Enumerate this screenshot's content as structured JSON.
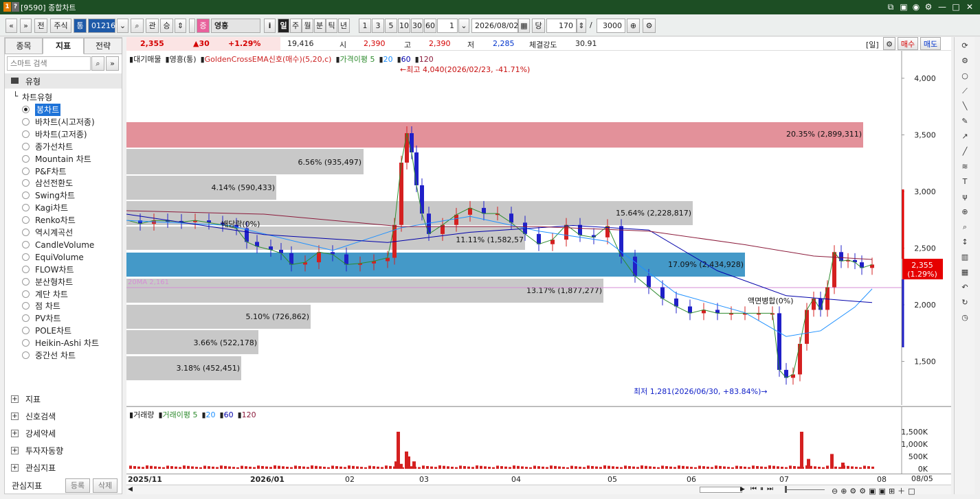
{
  "window": {
    "title": "[9590] 종합차트",
    "logo": "1 ?"
  },
  "toolbar": {
    "nav_prev": "«",
    "nav_down": "»",
    "before": "전",
    "asset_type": "주식",
    "tong": "통",
    "code": "012160",
    "gwan": "관",
    "seung": "승",
    "jeung": "증",
    "name": "영흥",
    "info": "i",
    "periods": [
      "일",
      "주",
      "월",
      "분",
      "틱",
      "년"
    ],
    "minutes": [
      "1",
      "3",
      "5",
      "10",
      "30",
      "60"
    ],
    "interval_value": "1",
    "date": "2026/08/02",
    "dang": "당",
    "count": "170",
    "slash": "/",
    "max_count": "3000"
  },
  "left_tabs": [
    "종목",
    "지표",
    "전략"
  ],
  "search_placeholder": "스마트 검색",
  "tree": {
    "root": "유형",
    "group": "차트유형",
    "items": [
      "봉차트",
      "바차트(시고저종)",
      "바차트(고저종)",
      "종가선차트",
      "Mountain 차트",
      "P&F차트",
      "삼선전환도",
      "Swing차트",
      "Kagi차트",
      "Renko차트",
      "역시계곡선",
      "CandleVolume",
      "EquiVolume",
      "FLOW차트",
      "분산형차트",
      "계단 차트",
      "점 차트",
      "PV차트",
      "POLE차트",
      "Heikin-Ashi 차트",
      "중간선 차트"
    ],
    "sections": [
      "지표",
      "신호검색",
      "강세약세",
      "투자자동향",
      "관심지표"
    ],
    "bottom_label": "관심지표",
    "register": "등록",
    "delete": "삭제"
  },
  "price_bar": {
    "last": "2,355",
    "change": "▲30",
    "pct": "+1.29%",
    "volume": "19,416",
    "open_label": "시",
    "open": "2,390",
    "high_label": "고",
    "high": "2,390",
    "low_label": "저",
    "low": "2,285",
    "strength_label": "체결강도",
    "strength": "30.91",
    "period_tag": "[일]",
    "buy": "매수",
    "sell": "매도"
  },
  "legend": {
    "items": [
      "대기매물",
      "영흥(통)",
      "GoldenCrossEMA신호(매수)(5,20,c)",
      "가격이평 5",
      "20",
      "60",
      "120"
    ],
    "colors": [
      "#222222",
      "#222222",
      "#cc2222",
      "#2e8b2e",
      "#1e90ff",
      "#0000aa",
      "#8b1a3a"
    ]
  },
  "annotations": {
    "high": "←최고 4,040(2026/02/23, -41.71%)",
    "low": "최저 1,281(2026/06/30, +83.84%)→",
    "split1": "배당락(0%)",
    "split2": "액면병합(0%)",
    "ma20": "20MA 2,161"
  },
  "bands": [
    {
      "label": "20.35% (2,899,311)",
      "color": "#e3919a"
    },
    {
      "label": "6.56% (935,497)",
      "color": "#c8c8c8"
    },
    {
      "label": "4.14% (590,433)",
      "color": "#c8c8c8"
    },
    {
      "label": "15.64% (2,228,817)",
      "color": "#c8c8c8"
    },
    {
      "label": "11.11% (1,582,57",
      "color": "#c8c8c8"
    },
    {
      "label": "17.09% (2,434,928)",
      "color": "#4499c8"
    },
    {
      "label": "13.17% (1,877,277)",
      "color": "#c8c8c8"
    },
    {
      "label": "5.10% (726,862)",
      "color": "#c8c8c8"
    },
    {
      "label": "3.66% (522,178)",
      "color": "#c8c8c8"
    },
    {
      "label": "3.18% (452,451)",
      "color": "#c8c8c8"
    }
  ],
  "y_axis": [
    "4,000",
    "3,500",
    "3,000",
    "2,500",
    "2,000",
    "1,500"
  ],
  "price_tag": {
    "value": "2,355",
    "pct": "(1.29%)",
    "color": "#e60000"
  },
  "volume_legend": {
    "items": [
      "거래량",
      "거래이평 5",
      "20",
      "60",
      "120"
    ],
    "colors": [
      "#222222",
      "#2e8b2e",
      "#1e90ff",
      "#0000aa",
      "#8b1a3a"
    ]
  },
  "volume_axis": [
    "1,500K",
    "1,000K",
    "500K",
    "0K"
  ],
  "x_axis": [
    "2025/11",
    "2026/01",
    "02",
    "03",
    "04",
    "05",
    "06",
    "07",
    "08"
  ],
  "last_date": "08/05"
}
